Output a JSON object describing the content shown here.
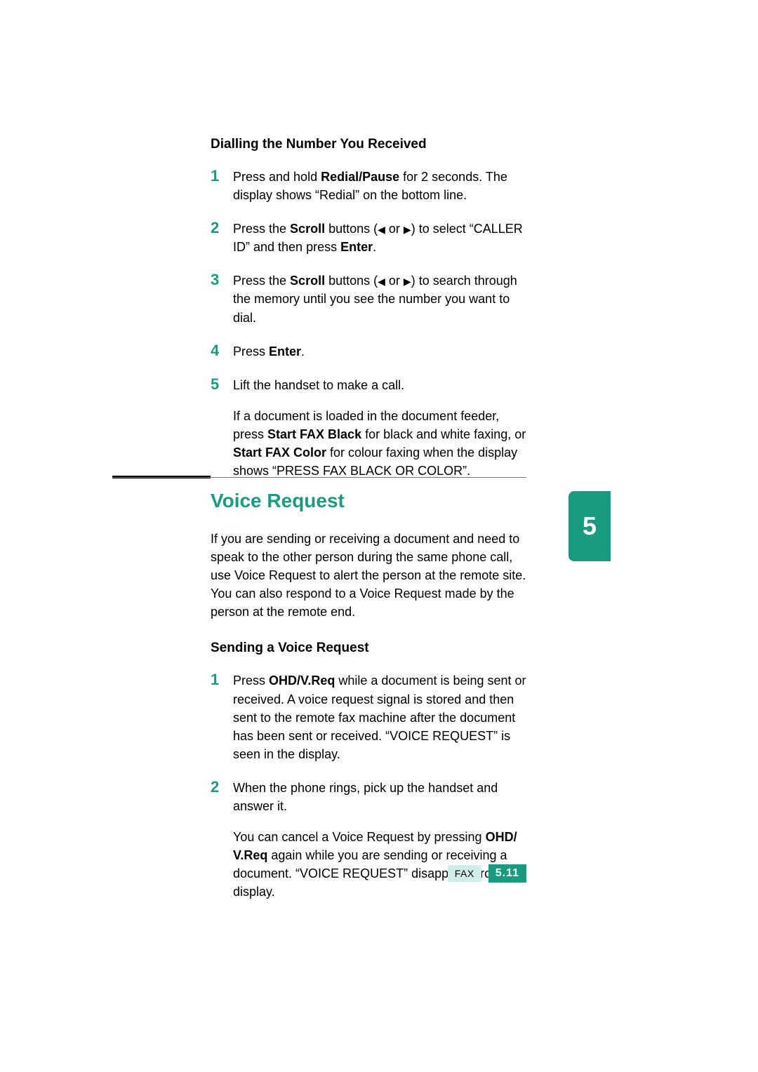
{
  "section1": {
    "heading": "Dialling the Number You Received",
    "steps": [
      {
        "num": "1",
        "parts": [
          {
            "t": "Press and hold "
          },
          {
            "t": "Redial/Pause",
            "b": true
          },
          {
            "t": " for 2 seconds. The display shows “Redial” on the bottom line."
          }
        ]
      },
      {
        "num": "2",
        "parts": [
          {
            "t": "Press the "
          },
          {
            "t": "Scroll",
            "b": true
          },
          {
            "t": " buttons ("
          },
          {
            "tri": "left"
          },
          {
            "t": " or "
          },
          {
            "tri": "right"
          },
          {
            "t": ") to select “CALLER ID” and then press "
          },
          {
            "t": "Enter",
            "b": true
          },
          {
            "t": "."
          }
        ]
      },
      {
        "num": "3",
        "parts": [
          {
            "t": "Press the "
          },
          {
            "t": "Scroll",
            "b": true
          },
          {
            "t": " buttons ("
          },
          {
            "tri": "left"
          },
          {
            "t": " or "
          },
          {
            "tri": "right"
          },
          {
            "t": ") to search through the memory until you see the number you want to dial."
          }
        ]
      },
      {
        "num": "4",
        "parts": [
          {
            "t": "Press "
          },
          {
            "t": "Enter",
            "b": true
          },
          {
            "t": "."
          }
        ]
      },
      {
        "num": "5",
        "paragraphs": [
          [
            {
              "t": "Lift the handset to make a call."
            }
          ],
          [
            {
              "t": "If a document is loaded in the document feeder, press "
            },
            {
              "t": "Start FAX Black",
              "b": true
            },
            {
              "t": " for black and white faxing, or "
            },
            {
              "t": "Start FAX Color",
              "b": true
            },
            {
              "t": " for colour faxing when the display shows “PRESS FAX BLACK OR COLOR”."
            }
          ]
        ]
      }
    ]
  },
  "section2": {
    "title": "Voice Request",
    "intro": "If you are sending or receiving a document and need to speak to the other person during the same phone call, use Voice Request to alert the person at the remote site. You can also respond to a Voice Request made by the person at the remote end.",
    "subheading": "Sending a Voice Request",
    "steps": [
      {
        "num": "1",
        "parts": [
          {
            "t": "Press "
          },
          {
            "t": "OHD/V.Req",
            "b": true
          },
          {
            "t": " while a document is being sent or received. A voice request signal is stored and then sent to the remote fax machine after the document has been sent or received. “VOICE REQUEST” is seen in the display."
          }
        ]
      },
      {
        "num": "2",
        "paragraphs": [
          [
            {
              "t": "When the phone rings, pick up the handset and answer it."
            }
          ],
          [
            {
              "t": "You can cancel a Voice Request by pressing "
            },
            {
              "t": "OHD/ V.Req",
              "b": true
            },
            {
              "t": " again while you are sending or receiving a document. “VOICE REQUEST” disappears from the display."
            }
          ]
        ]
      }
    ]
  },
  "chapter_tab": "5",
  "footer": {
    "label": "FAX",
    "page": "5.11"
  },
  "icons": {
    "tri_left": "◀",
    "tri_right": "▶"
  }
}
